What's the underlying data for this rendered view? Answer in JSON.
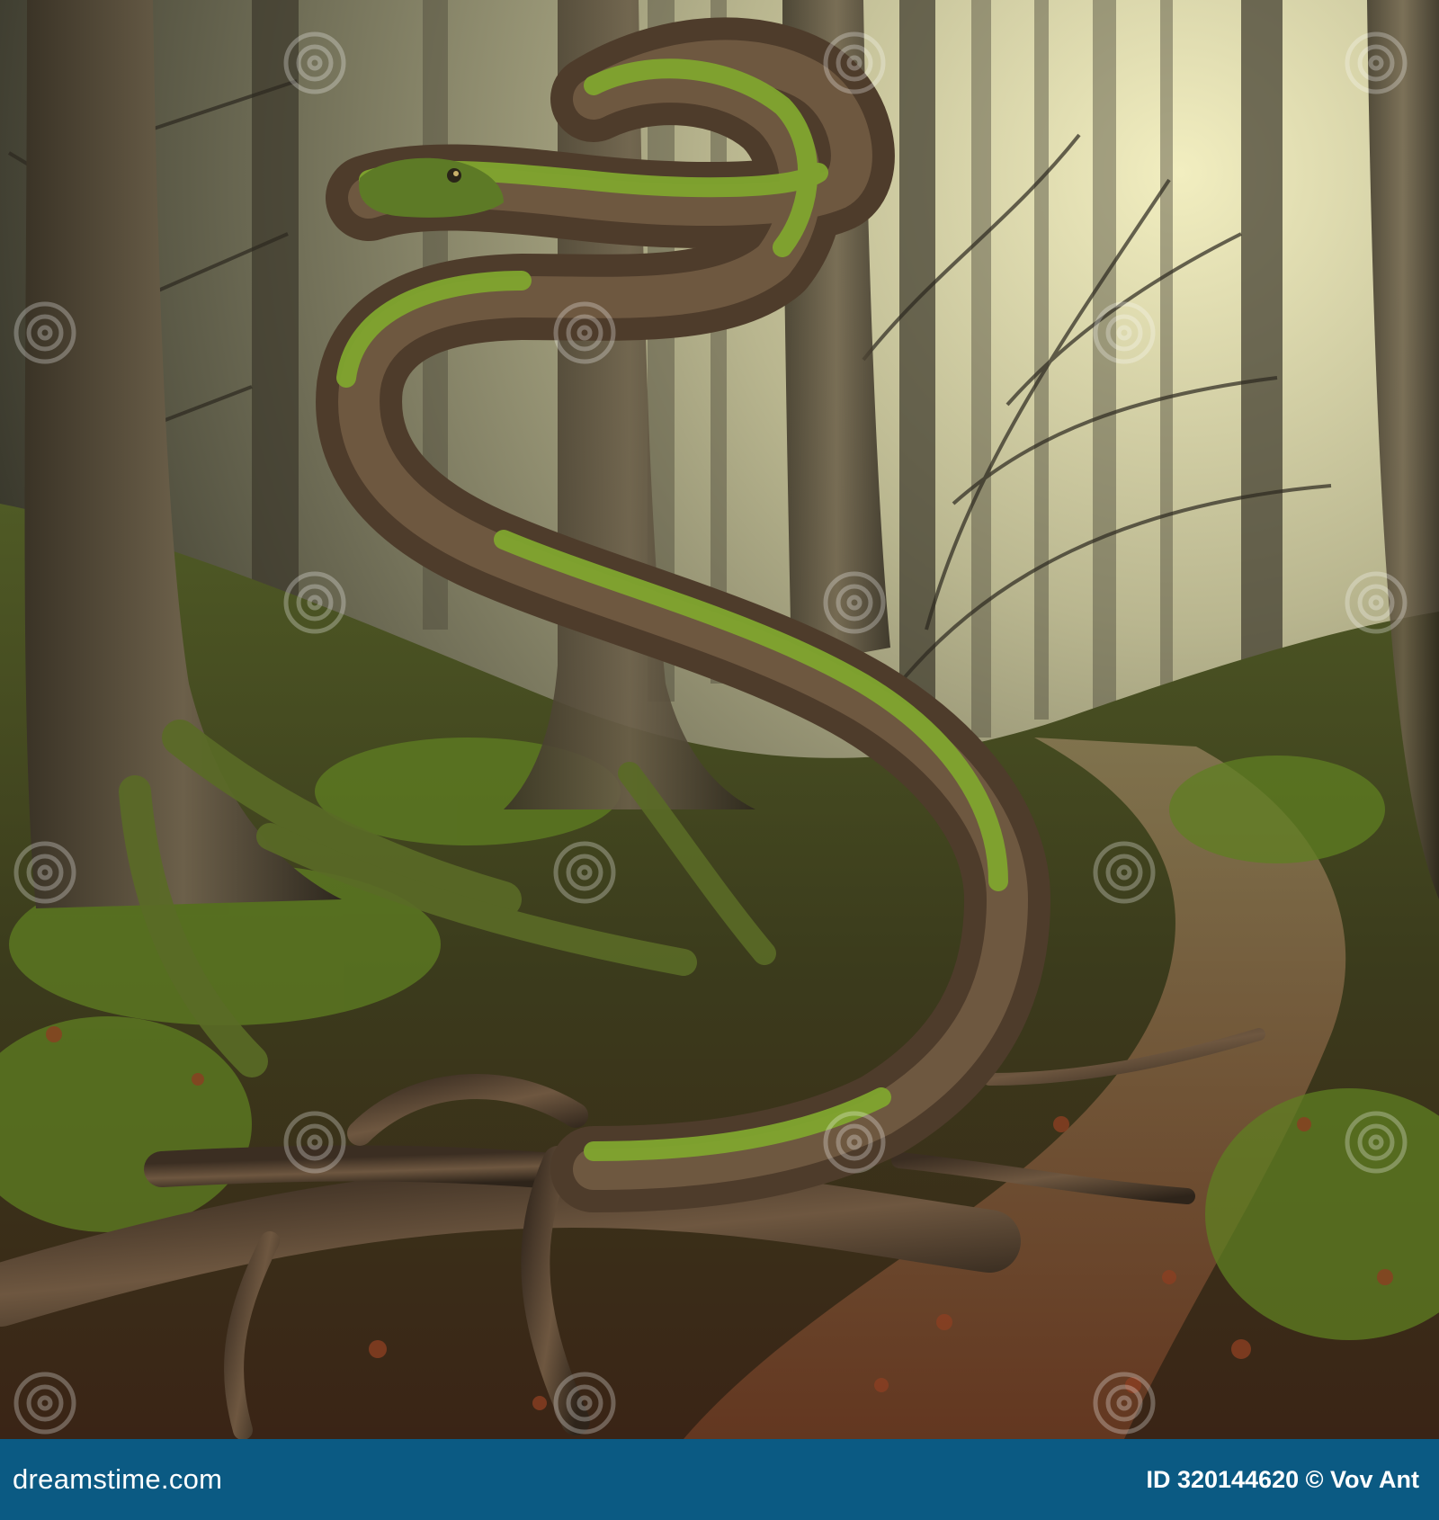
{
  "footer": {
    "brand": "dreamstime.com",
    "credit": "ID 320144620 © Vov Ant"
  },
  "watermark": {
    "text": "dreamstime",
    "icon": "spiral-logo-icon"
  },
  "colors": {
    "footer_bg": "#0b5a83",
    "moss": "#6b8f2a",
    "wood": "#5b4631",
    "fog": "#c9c7a4",
    "leaves": "#7a3b22"
  }
}
